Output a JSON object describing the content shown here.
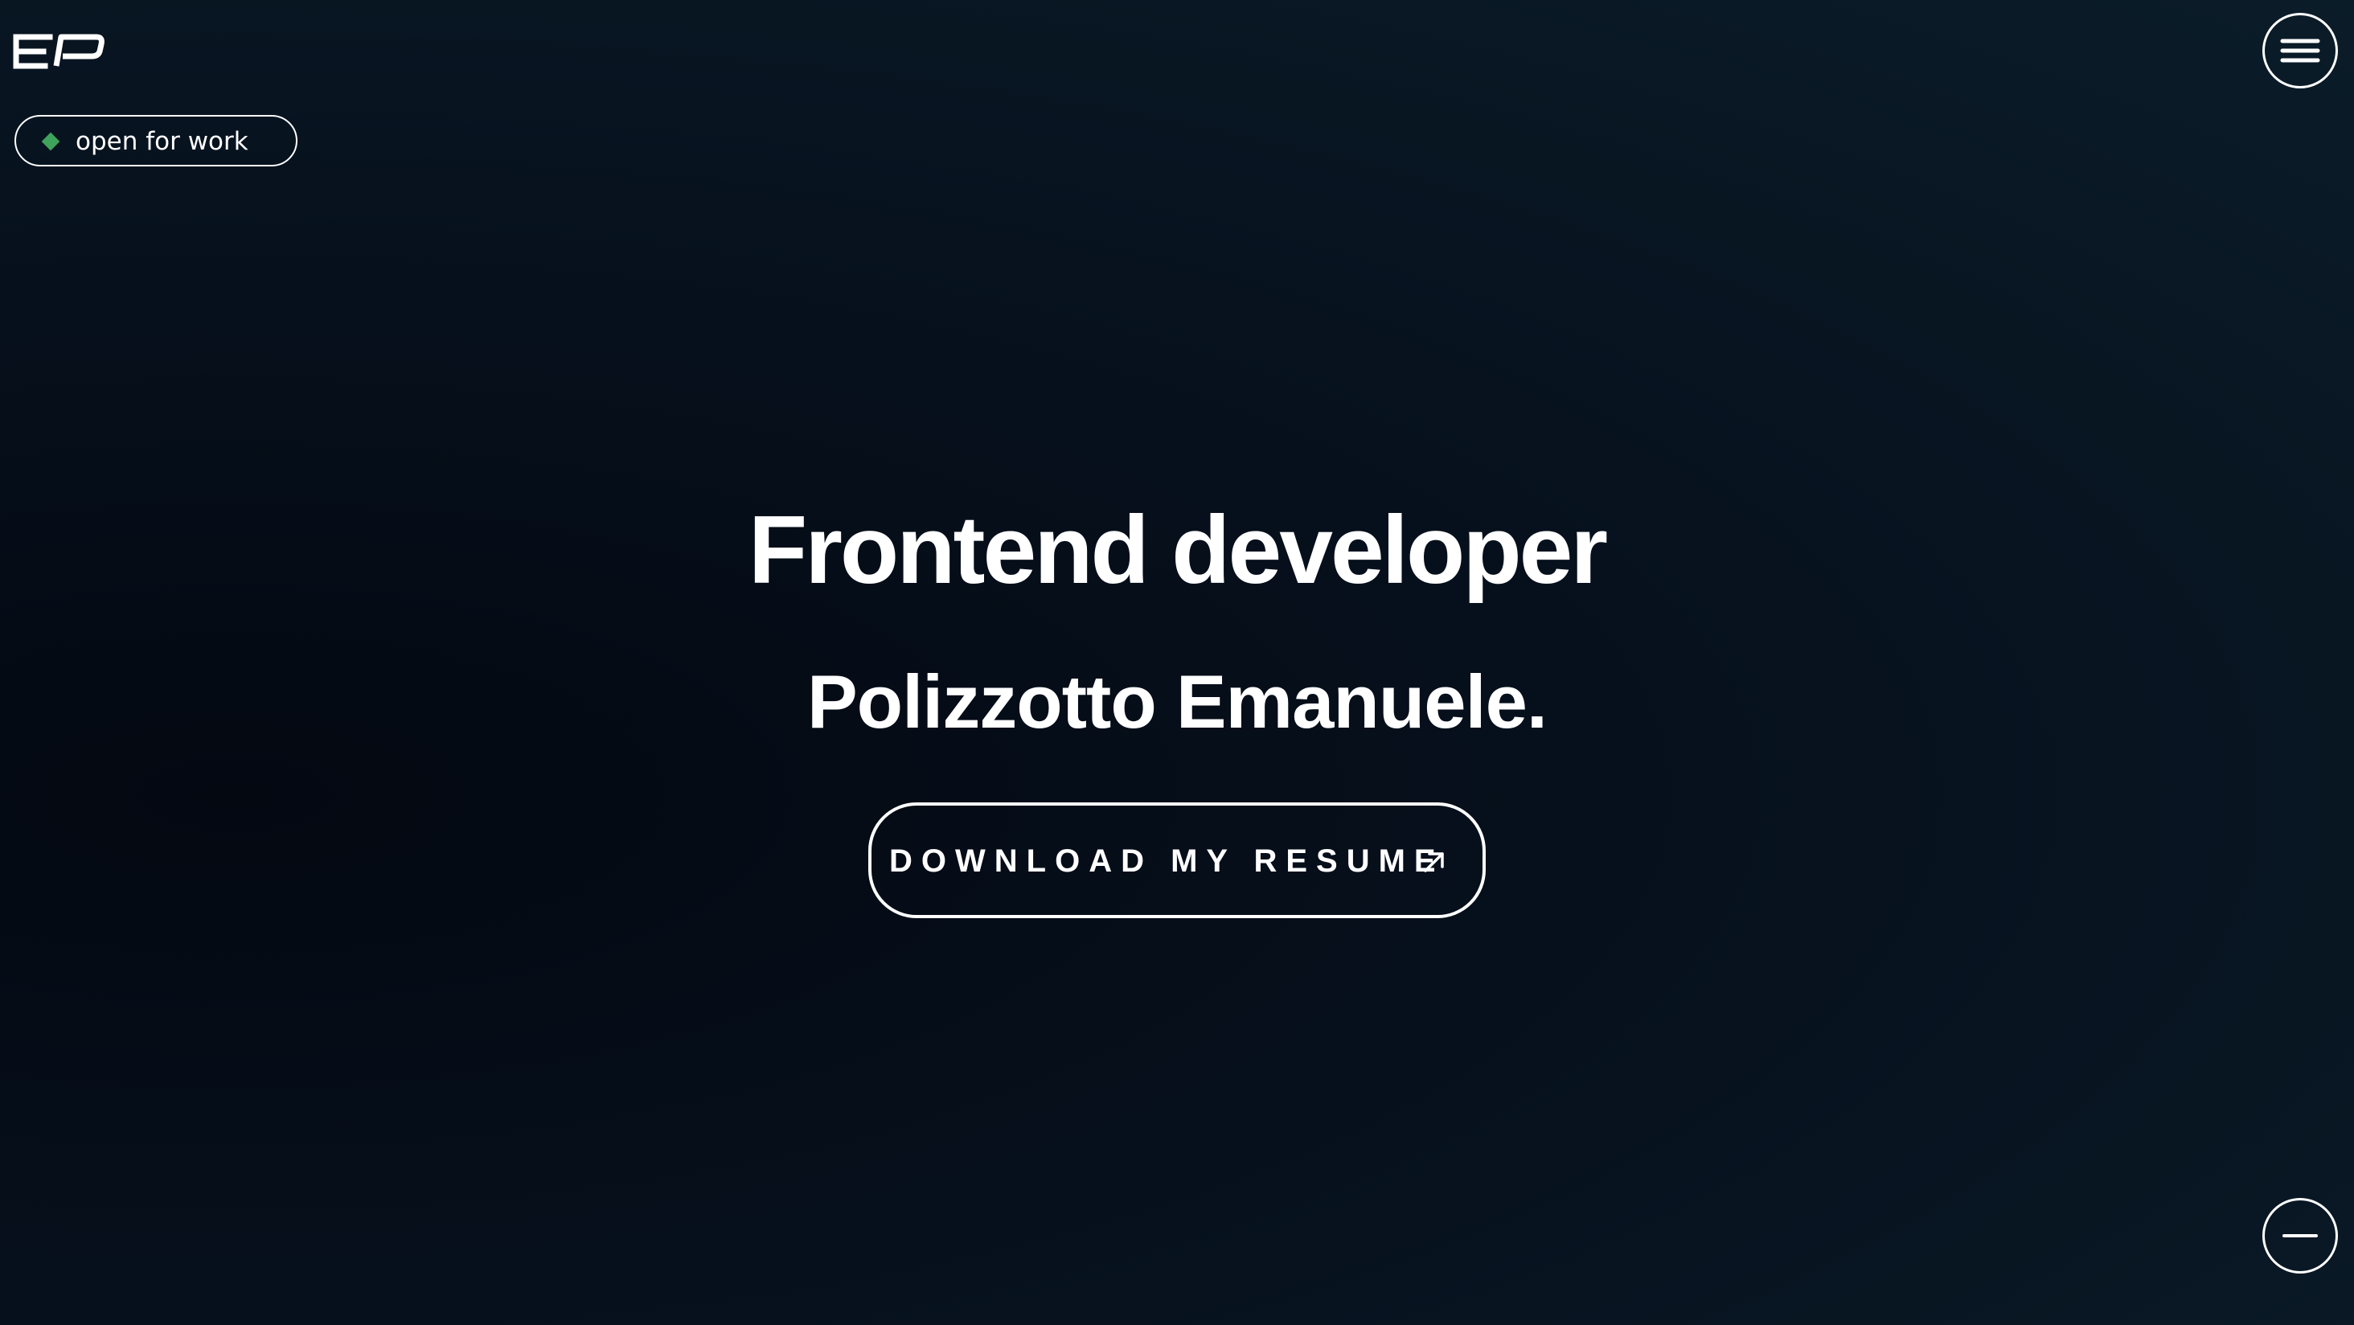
{
  "header": {
    "logo_icon": "ep-monogram-logo",
    "status_badge": {
      "label": "open for work",
      "indicator_color": "#3fa45b",
      "indicator_icon": "diamond-status-icon"
    },
    "menu_icon": "hamburger-menu-icon"
  },
  "hero": {
    "title": "Frontend developer",
    "name": "Polizzotto Emanuele.",
    "cta": {
      "label": "DOWNLOAD MY RESUME",
      "icon": "arrow-up-right-icon"
    }
  },
  "footer": {
    "collapse_icon": "minus-icon"
  },
  "colors": {
    "background_dark": "#040811",
    "background_light": "#0b1c29",
    "foreground": "#ffffff",
    "accent": "#3fa45b"
  }
}
